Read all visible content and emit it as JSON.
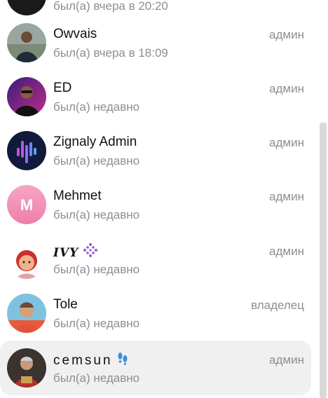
{
  "members": [
    {
      "name": "",
      "status": "был(а) вчера в 20:20",
      "role": ""
    },
    {
      "name": "Owvais",
      "status": "был(а) вчера в 18:09",
      "role": "админ"
    },
    {
      "name": "ED",
      "status": "был(а) недавно",
      "role": "админ"
    },
    {
      "name": "Zignaly Admin",
      "status": "был(а) недавно",
      "role": "админ"
    },
    {
      "name": "Mehmet",
      "status": "был(а) недавно",
      "role": "админ",
      "avatar_letter": "M"
    },
    {
      "name": "IVY",
      "status": "был(а) недавно",
      "role": "админ"
    },
    {
      "name": "Tole",
      "status": "был(а) недавно",
      "role": "владелец"
    },
    {
      "name": "cemsun",
      "status": "был(а) недавно",
      "role": "админ"
    }
  ],
  "colors": {
    "secondary_text": "#8e8e93",
    "selected_row": "#f0f0f0",
    "mehmet_avatar": "#f48fb1",
    "zignaly_avatar": "#111a3a",
    "scrollbar": "#d9d9d9"
  },
  "icons": [
    "diamond-dots-icon",
    "footprints-icon"
  ]
}
